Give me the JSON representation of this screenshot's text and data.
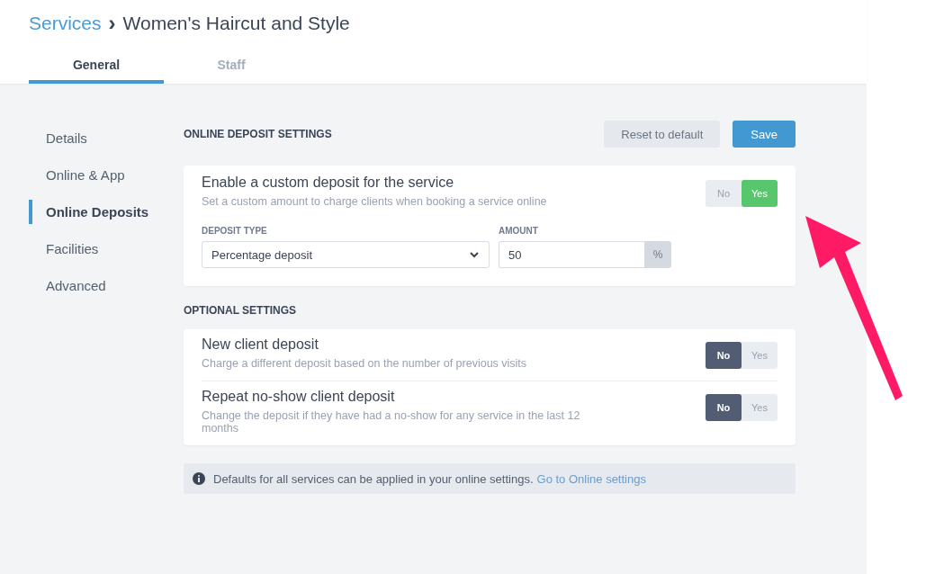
{
  "breadcrumb": {
    "parent": "Services",
    "separator": "›",
    "current": "Women's Haircut and Style"
  },
  "tabs": [
    {
      "label": "General",
      "selected": true
    },
    {
      "label": "Staff",
      "selected": false
    }
  ],
  "sidebar": {
    "items": [
      {
        "label": "Details",
        "selected": false
      },
      {
        "label": "Online & App",
        "selected": false
      },
      {
        "label": "Online Deposits",
        "selected": true
      },
      {
        "label": "Facilities",
        "selected": false
      },
      {
        "label": "Advanced",
        "selected": false
      }
    ]
  },
  "deposit_section": {
    "heading": "ONLINE DEPOSIT SETTINGS",
    "buttons": [
      {
        "label": "Reset to default",
        "kind": "secondary"
      },
      {
        "label": "Save",
        "kind": "primary"
      }
    ],
    "card": {
      "title": "Enable a custom deposit for the service",
      "description": "Set a custom amount to charge clients when booking a service online",
      "toggle": [
        {
          "label": "No",
          "selected": false
        },
        {
          "label": "Yes",
          "selected": true
        }
      ],
      "deposit_type": {
        "label": "DEPOSIT TYPE",
        "value": "Percentage deposit"
      },
      "amount": {
        "label": "AMOUNT",
        "value": "50",
        "unit": "%"
      }
    }
  },
  "optional_section": {
    "heading": "OPTIONAL SETTINGS",
    "rows": [
      {
        "title": "New client deposit",
        "description": "Charge a different deposit based on the number of previous visits",
        "toggle": [
          {
            "label": "No",
            "selected": true
          },
          {
            "label": "Yes",
            "selected": false
          }
        ]
      },
      {
        "title": "Repeat no-show client deposit",
        "description": "Change the deposit if they have had a no-show for any service in the last 12 months",
        "toggle": [
          {
            "label": "No",
            "selected": true
          },
          {
            "label": "Yes",
            "selected": false
          }
        ]
      }
    ]
  },
  "info_banner": {
    "text": "Defaults for all services can be applied in your online settings.",
    "link": "Go to Online settings"
  }
}
